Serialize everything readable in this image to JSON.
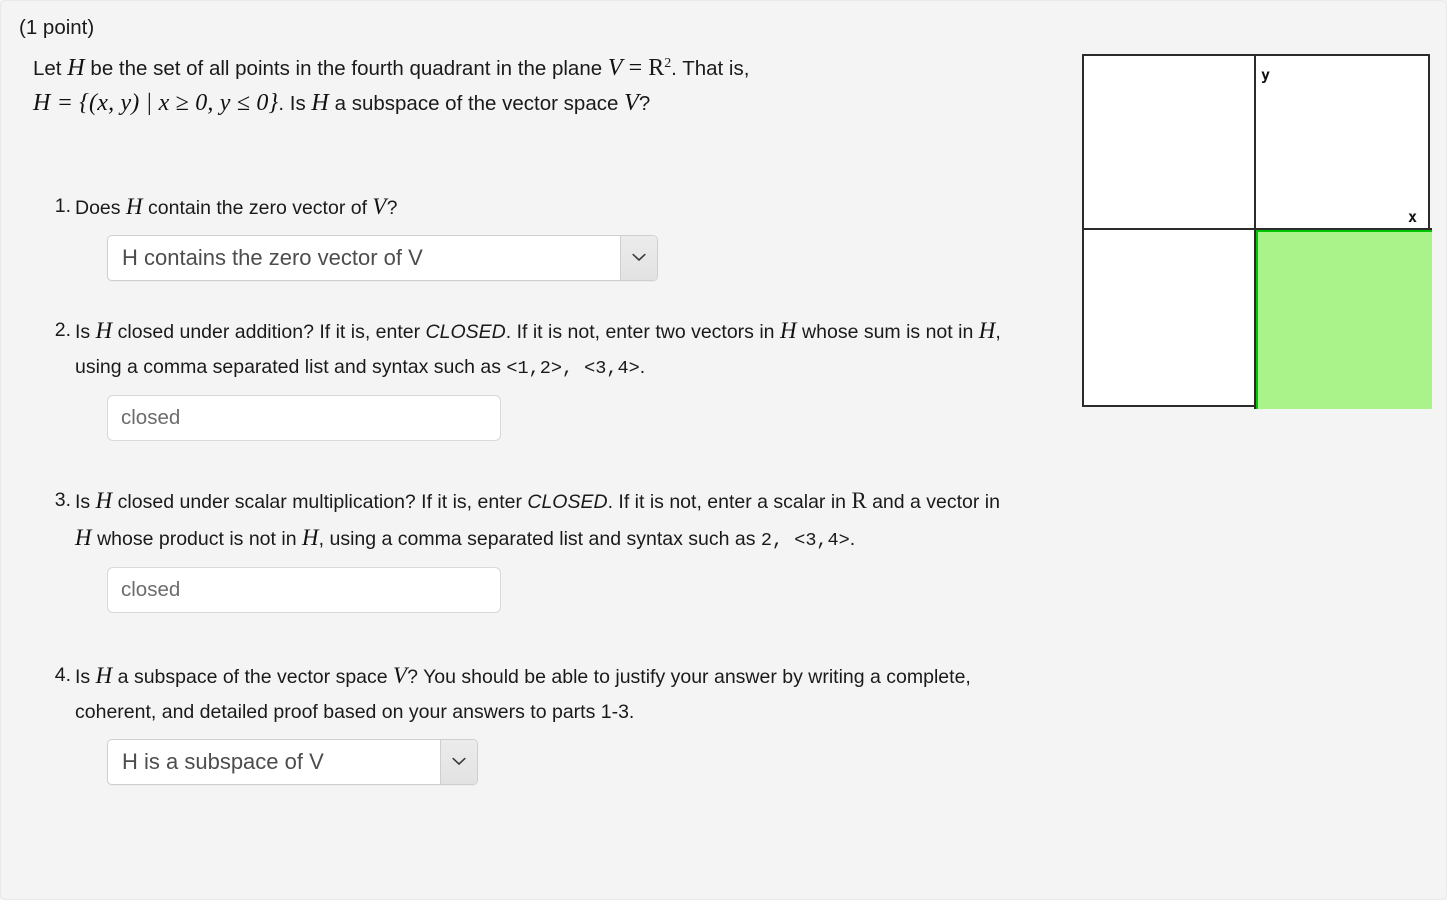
{
  "header": {
    "point_label": "(1 point)"
  },
  "problem": {
    "line1_a": "Let ",
    "line1_H": "H",
    "line1_b": " be the set of all points in the fourth quadrant in the plane ",
    "line1_V": "V",
    "line1_eq": " = ",
    "line1_R": "R",
    "line1_exp": "2",
    "line1_c": ". That is,",
    "line2_set": "H = {(x, y) | x ≥ 0, y ≤ 0}",
    "line2_a": ". Is ",
    "line2_H": "H",
    "line2_b": " a subspace of the vector space ",
    "line2_V": "V",
    "line2_q": "?"
  },
  "parts": [
    {
      "number": "1.",
      "text_a": "Does ",
      "var1": "H",
      "text_b": " contain the zero vector of ",
      "var2": "V",
      "text_c": "?",
      "control": "select",
      "value": "H contains the zero vector of V",
      "arrow_icon": "chevron-down-icon"
    },
    {
      "number": "2.",
      "text_a": "Is ",
      "var1": "H",
      "text_b": " closed under addition? If it is, enter ",
      "emph": "CLOSED",
      "text_c": ". If it is not, enter two vectors in ",
      "var2": "H",
      "text_d": " whose sum is not in ",
      "var3": "H",
      "text_e": ", using a comma separated list and syntax such as ",
      "code": "<1,2>, <3,4>",
      "text_f": ".",
      "control": "text",
      "value": "closed"
    },
    {
      "number": "3.",
      "text_a": "Is ",
      "var1": "H",
      "text_b": " closed under scalar multiplication? If it is, enter ",
      "emph": "CLOSED",
      "text_c": ". If it is not, enter a scalar in ",
      "var2": "R",
      "text_d": " and a vector in ",
      "var3": "H",
      "text_e": " whose product is not in ",
      "var4": "H",
      "text_f": ", using a comma separated list and syntax such as ",
      "code": "2, <3,4>",
      "text_g": ".",
      "control": "text",
      "value": "closed"
    },
    {
      "number": "4.",
      "text_a": "Is ",
      "var1": "H",
      "text_b": " a subspace of the vector space ",
      "var2": "V",
      "text_c": "? You should be able to justify your answer by writing a complete, coherent, and detailed proof based on your answers to parts 1-3.",
      "control": "select",
      "value": "H is a subspace of V",
      "arrow_icon": "chevron-down-icon"
    }
  ],
  "graph": {
    "x_axis_label": "x",
    "y_axis_label": "y",
    "shaded_quadrant": "fourth",
    "fill_color": "#aaf28a",
    "outline_color": "#00c400",
    "axis_color": "#2b2b2b",
    "background": "#ffffff"
  },
  "colors": {
    "page_background": "#f4f4f4",
    "text": "#1a1a1a",
    "input_text": "#6c6c6c",
    "select_text": "#4d4d4d",
    "border": "#cfcfcf"
  }
}
